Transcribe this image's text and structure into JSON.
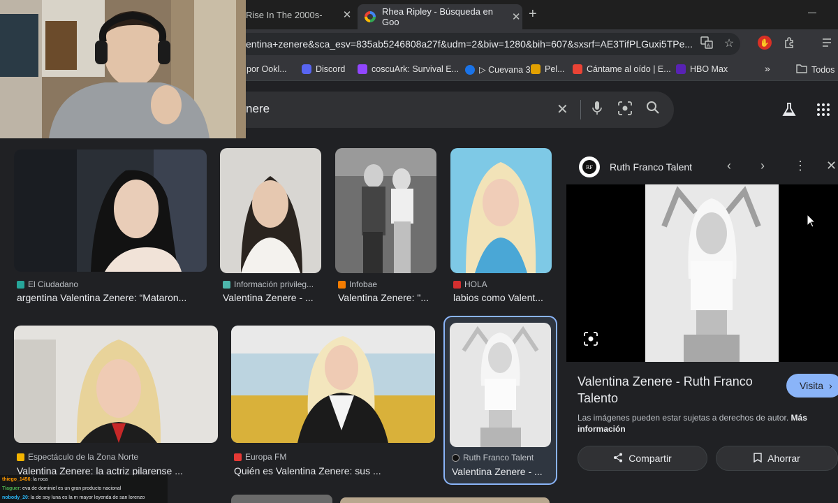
{
  "tabs": [
    {
      "title": "Rise In The 2000s-",
      "close": "✕"
    },
    {
      "title": "Rhea Ripley - Búsqueda en Goo",
      "close": "✕"
    }
  ],
  "new_tab": "+",
  "address": {
    "url": "entina+zenere&sca_esv=835ab5246808a27f&udm=2&biw=1280&bih=607&sxsrf=AE3TifPLGuxi5TPe..."
  },
  "toolbar_icons": [
    "translate-icon",
    "star-icon",
    "extension-red-icon",
    "puzzle-icon",
    "menu-icon"
  ],
  "bookmarks": [
    {
      "label": "por Ookl...",
      "color": "#3c4043"
    },
    {
      "label": "Discord",
      "color": "#5865f2"
    },
    {
      "label": "coscuArk: Survival E...",
      "color": "#9146ff"
    },
    {
      "label": "▷ Cuevana 3",
      "color": "#1a73e8"
    },
    {
      "label": "Pel...",
      "color": "#e2a000"
    },
    {
      "label": "Cántame al oído | E...",
      "color": "#ea4335"
    },
    {
      "label": "HBO Max",
      "color": "#5822b4"
    },
    {
      "label": "»",
      "color": ""
    },
    {
      "label": "Todos",
      "color": ""
    }
  ],
  "search": {
    "query": "nere"
  },
  "results": [
    {
      "source": "El Ciudadano",
      "title": "argentina Valentina Zenere: “Mataron...",
      "fav": "#26a69a"
    },
    {
      "source": "Información privileg...",
      "title": "Valentina Zenere - ...",
      "fav": "#4db6ac"
    },
    {
      "source": "Infobae",
      "title": "Valentina Zenere: \"...",
      "fav": "#f57c00"
    },
    {
      "source": "HOLA",
      "title": "labios como Valent...",
      "fav": "#d32f2f"
    },
    {
      "source": "Espectáculo de la Zona Norte",
      "title": "Valentina Zenere: la actriz pilarense ...",
      "fav": "#f4b400"
    },
    {
      "source": "Europa FM",
      "title": "Quién es Valentina Zenere: sus ...",
      "fav": "#e53935"
    },
    {
      "source": "Ruth Franco Talent",
      "title": "Valentina Zenere - ...",
      "fav": "#111111"
    }
  ],
  "panel": {
    "source": "Ruth Franco Talent",
    "logo_text": "RF",
    "title": "Valentina Zenere - Ruth Franco Talento",
    "visit": "Visita",
    "note": "Las imágenes pueden estar sujetas a derechos de autor.",
    "note_link": "Más información",
    "share": "Compartir",
    "save": "Ahorrar"
  },
  "chat": [
    {
      "user": "thiego_1456",
      "text": ": la roca",
      "color": "#ff9800"
    },
    {
      "user": "Tiaguer",
      "text": ": eva de dominiel es un gran producto nacional",
      "color": "#4caf50"
    },
    {
      "user": "nobody_20",
      "text": ": la de soy luna es la m mayor leyenda de san lorenzo",
      "color": "#29b6f6"
    }
  ]
}
